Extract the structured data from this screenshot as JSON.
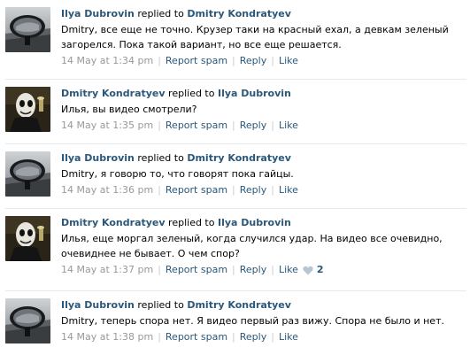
{
  "comments": [
    {
      "author": "Ilya Dubrovin",
      "replied": "replied to",
      "target": "Dmitry Kondratyev",
      "text": "Dmitry, все еще не точно. Крузер таки на красный ехал, а девкам зеленый загорелся. Пока такой вариант, но все еще решается.",
      "date": "14 May at 1:34 pm",
      "report": "Report spam",
      "reply": "Reply",
      "like": "Like",
      "avatar_icon": "car-mirror-avatar-icon"
    },
    {
      "author": "Dmitry Kondratyev",
      "replied": "replied to",
      "target": "Ilya Dubrovin",
      "text": "Илья, вы видео смотрели?",
      "date": "14 May at 1:35 pm",
      "report": "Report spam",
      "reply": "Reply",
      "like": "Like",
      "avatar_icon": "masked-face-avatar-icon"
    },
    {
      "author": "Ilya Dubrovin",
      "replied": "replied to",
      "target": "Dmitry Kondratyev",
      "text": "Dmitry, я говорю то, что говорят пока гайцы.",
      "date": "14 May at 1:36 pm",
      "report": "Report spam",
      "reply": "Reply",
      "like": "Like",
      "avatar_icon": "car-mirror-avatar-icon"
    },
    {
      "author": "Dmitry Kondratyev",
      "replied": "replied to",
      "target": "Ilya Dubrovin",
      "text": "Илья, еще моргал зеленый, когда случился удар. На видео все очевидно, очевиднее не бывает. О чем спор?",
      "date": "14 May at 1:37 pm",
      "report": "Report spam",
      "reply": "Reply",
      "like": "Like",
      "like_count": "2",
      "avatar_icon": "masked-face-avatar-icon"
    },
    {
      "author": "Ilya Dubrovin",
      "replied": "replied to",
      "target": "Dmitry Kondratyev",
      "text": "Dmitry, теперь спора нет. Я видео первый раз вижу. Спора не было и нет.",
      "date": "14 May at 1:38 pm",
      "report": "Report spam",
      "reply": "Reply",
      "like": "Like",
      "avatar_icon": "car-mirror-avatar-icon"
    }
  ],
  "colors": {
    "link": "#2b587a",
    "meta": "#999999",
    "divider": "#e7eaed"
  }
}
